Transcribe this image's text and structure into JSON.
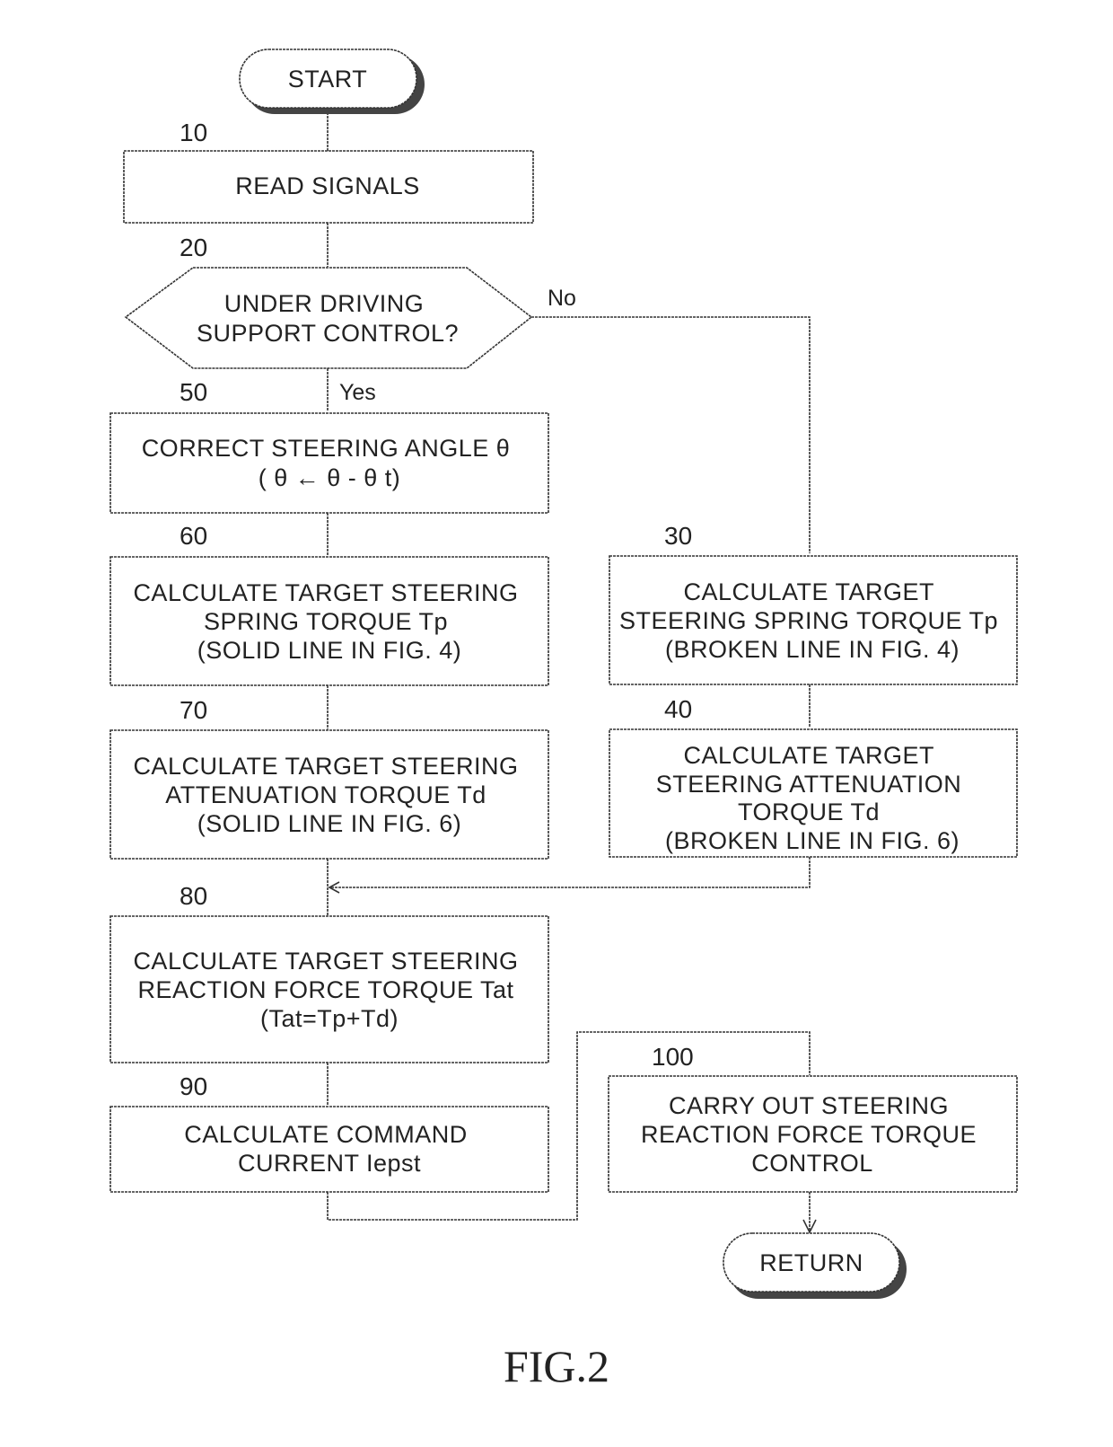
{
  "figure": {
    "caption": "FIG.2",
    "start": "START",
    "end": "RETURN"
  },
  "steps": {
    "s10": {
      "number": "10",
      "lines": [
        "READ SIGNALS"
      ]
    },
    "s20": {
      "number": "20",
      "lines": [
        "UNDER DRIVING",
        "SUPPORT CONTROL?"
      ],
      "yes_label": "Yes",
      "no_label": "No"
    },
    "s50": {
      "number": "50",
      "lines": [
        "CORRECT STEERING ANGLE θ",
        "( θ ← θ - θ t)"
      ]
    },
    "s60": {
      "number": "60",
      "lines": [
        "CALCULATE TARGET STEERING",
        "SPRING TORQUE Tp",
        "(SOLID LINE IN FIG. 4)"
      ]
    },
    "s70": {
      "number": "70",
      "lines": [
        "CALCULATE TARGET STEERING",
        "ATTENUATION TORQUE Td",
        "(SOLID LINE IN FIG. 6)"
      ]
    },
    "s30": {
      "number": "30",
      "lines": [
        "CALCULATE TARGET",
        "STEERING SPRING TORQUE Tp",
        "(BROKEN LINE IN FIG. 4)"
      ]
    },
    "s40": {
      "number": "40",
      "lines": [
        "CALCULATE TARGET",
        "STEERING ATTENUATION",
        "TORQUE Td",
        "(BROKEN LINE IN FIG. 6)"
      ]
    },
    "s80": {
      "number": "80",
      "lines": [
        "CALCULATE TARGET STEERING",
        "REACTION FORCE TORQUE Tat",
        "(Tat=Tp+Td)"
      ]
    },
    "s90": {
      "number": "90",
      "lines": [
        "CALCULATE COMMAND",
        "CURRENT Iepst"
      ]
    },
    "s100": {
      "number": "100",
      "lines": [
        "CARRY OUT STEERING",
        "REACTION FORCE TORQUE",
        "CONTROL"
      ]
    }
  }
}
